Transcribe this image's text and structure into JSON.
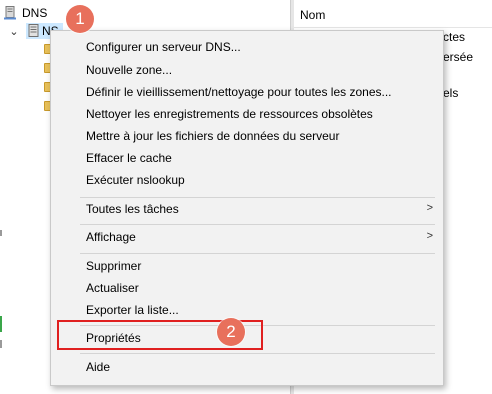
{
  "tree": {
    "root_label": "DNS",
    "server_label": "NS",
    "root_icon": "server-icon",
    "server_icon": "server-icon",
    "folder_icon": "folder-icon"
  },
  "right_pane": {
    "column_header": "Nom",
    "fragments": [
      "ctes",
      "ersée",
      "els"
    ]
  },
  "context_menu": {
    "items": [
      {
        "label": "Configurer un serveur DNS..."
      },
      {
        "label": "Nouvelle zone..."
      },
      {
        "label": "Définir le vieillissement/nettoyage pour toutes les zones..."
      },
      {
        "label": "Nettoyer les enregistrements de ressources obsolètes"
      },
      {
        "label": "Mettre à jour les fichiers de données du serveur"
      },
      {
        "label": "Effacer le cache"
      },
      {
        "label": "Exécuter nslookup"
      },
      {
        "label": "Toutes les tâches",
        "submenu": ">"
      },
      {
        "label": "Affichage",
        "submenu": ">"
      },
      {
        "label": "Supprimer"
      },
      {
        "label": "Actualiser"
      },
      {
        "label": "Exporter la liste..."
      },
      {
        "label": "Propriétés"
      },
      {
        "label": "Aide"
      }
    ]
  },
  "annotations": {
    "step1": "1",
    "step2": "2",
    "highlight_color": "#e02020",
    "badge_color": "#e8705c"
  },
  "colors": {
    "selection": "#cce8ff",
    "menu_background": "#f2f2f2"
  }
}
